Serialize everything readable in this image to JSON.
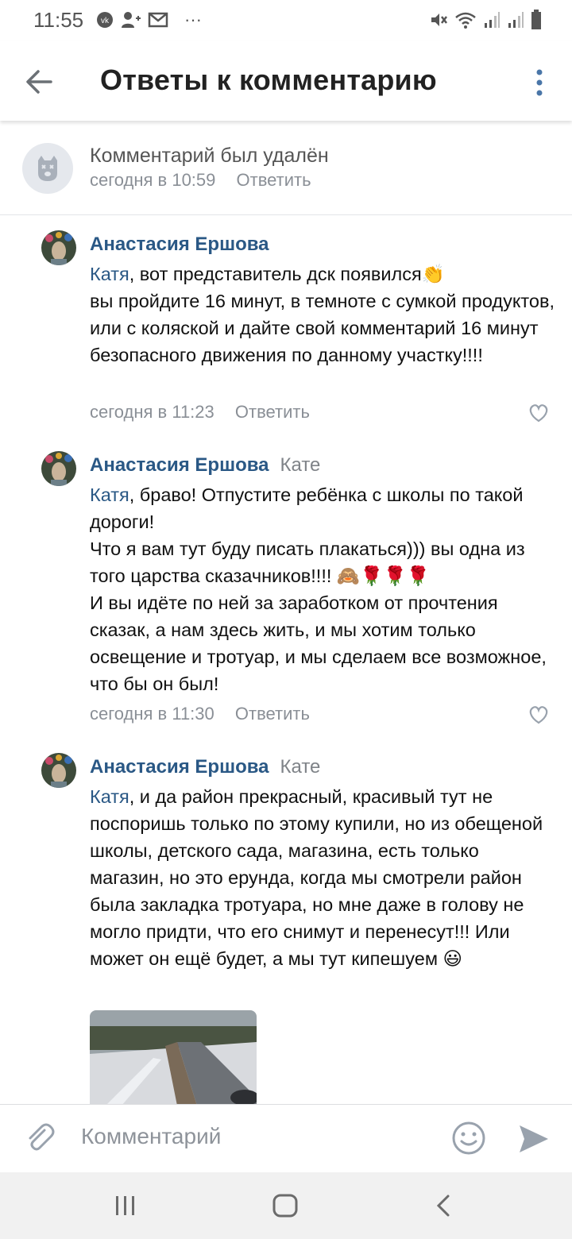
{
  "status_bar": {
    "time": "11:55",
    "left_icons": [
      "vk-icon",
      "add-user-icon",
      "mail-icon",
      "more-dots-icon"
    ],
    "right_icons": [
      "mute-icon",
      "wifi-icon",
      "signal-icon",
      "signal-icon",
      "battery-icon"
    ],
    "more": "···"
  },
  "header": {
    "title": "Ответы к комментарию"
  },
  "deleted_comment": {
    "text": "Комментарий был удалён",
    "time": "сегодня в 10:59",
    "reply": "Ответить"
  },
  "comments": [
    {
      "author": "Анастасия Ершова",
      "reply_to": "",
      "mention": "Катя",
      "text": ", вот представитель дск появился👏\nвы пройдите 16 минут, в темноте с сумкой продуктов, или с коляской и дайте свой комментарий 16 минут безопасного движения по данному участку!!!!",
      "time": "сегодня в 11:23",
      "reply": "Ответить"
    },
    {
      "author": "Анастасия Ершова",
      "reply_to": "Кате",
      "mention": "Катя",
      "text": ", браво! Отпустите ребёнка с школы по такой дороги!\nЧто я вам тут буду писать плакаться))) вы одна из того царства сказачников!!!! 🙈🌹🌹🌹\nИ вы идёте по ней за заработком от прочтения сказак, а нам здесь жить, и мы хотим только освещение и тротуар, и мы сделаем все возможное, что бы он был!",
      "time": "сегодня в 11:30",
      "reply": "Ответить"
    },
    {
      "author": "Анастасия Ершова",
      "reply_to": "Кате",
      "mention": "Катя",
      "text": ", и да район прекрасный, красивый тут не поспоришь только по этому купили, но из обещеной школы, детского сада, магазина, есть только магазин, но это ерунда, когда мы смотрели район была закладка тротуара, но мне даже в голову не могло придти, что его снимут и перенесут!!! Или может он ещё будет, а мы тут кипешуем 😃"
    }
  ],
  "input_bar": {
    "placeholder": "Комментарий"
  },
  "colors": {
    "link": "#2a5885",
    "meta": "#8a8f96",
    "accent": "#4a76a8"
  }
}
